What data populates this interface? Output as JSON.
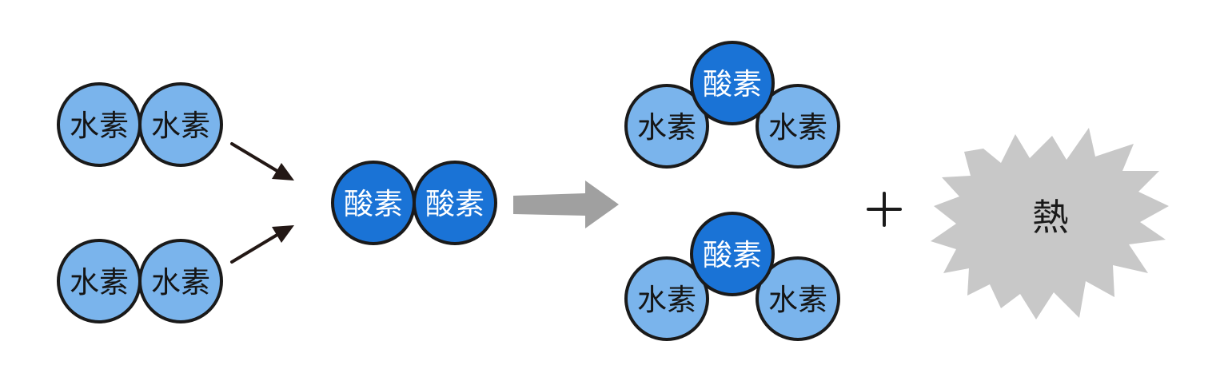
{
  "atoms": {
    "hydrogen": "水素",
    "oxygen": "酸素"
  },
  "product": {
    "heat": "熱"
  },
  "colors": {
    "hydrogen_fill": "#7ab4ec",
    "oxygen_fill": "#1a73d6",
    "outline": "#1a1a1a",
    "reaction_arrow": "#a0a0a0",
    "heat_burst": "#c8c8c8"
  },
  "icons": {
    "reaction_arrow": "block-arrow-right-icon",
    "input_arrows": "arrow-icon",
    "plus": "plus-icon",
    "heat": "burst-icon"
  }
}
